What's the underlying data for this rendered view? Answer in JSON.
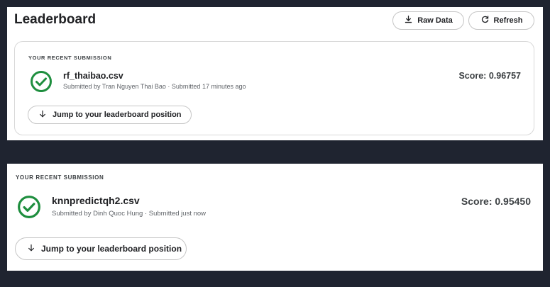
{
  "leaderboard": {
    "title": "Leaderboard",
    "raw_data_label": "Raw Data",
    "refresh_label": "Refresh"
  },
  "submissions": [
    {
      "section_label": "YOUR RECENT SUBMISSION",
      "file_name": "rf_thaibao.csv",
      "submitted_by": "Submitted by Tran Nguyen Thai Bao · Submitted 17 minutes ago",
      "score": "Score: 0.96757",
      "jump_label": "Jump to your leaderboard position"
    },
    {
      "section_label": "YOUR RECENT SUBMISSION",
      "file_name": "knnpredictqh2.csv",
      "submitted_by": "Submitted by Dinh Quoc Hung · Submitted just now",
      "score": "Score: 0.95450",
      "jump_label": "Jump to your leaderboard position"
    }
  ],
  "colors": {
    "success_green": "#1e8e3e",
    "background_dark": "#1f2430"
  }
}
